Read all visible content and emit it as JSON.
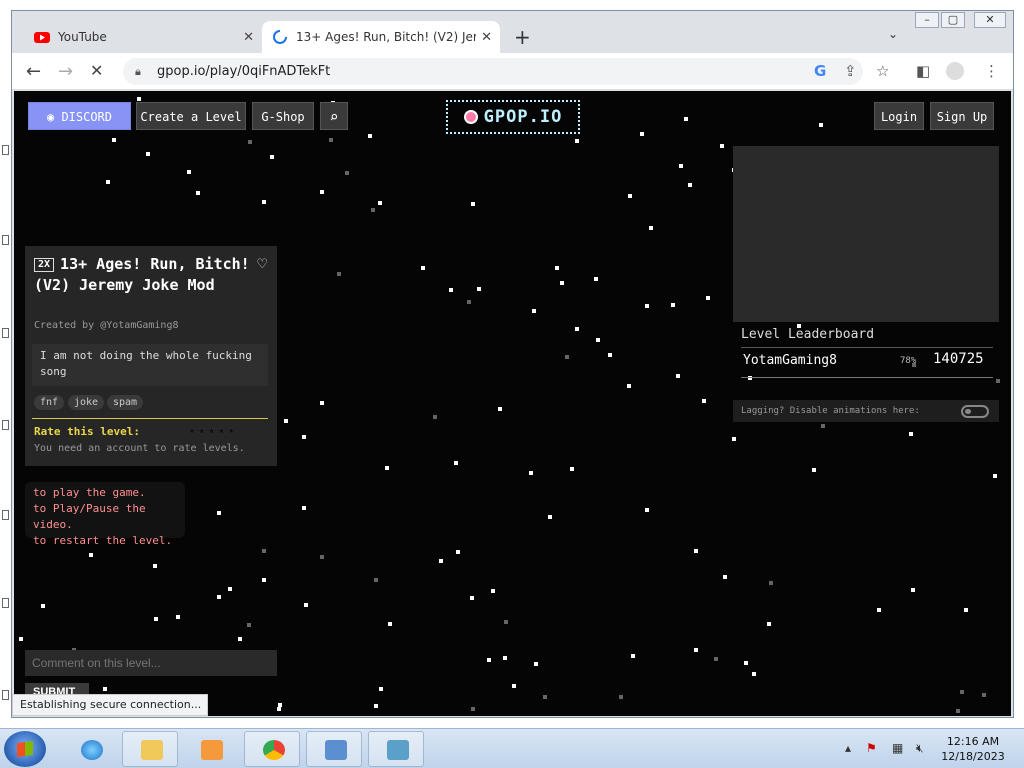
{
  "browser": {
    "tabs": [
      {
        "title": "YouTube",
        "icon": "youtube-icon",
        "active": false
      },
      {
        "title": "13+ Ages! Run, Bitch! (V2) Jerem",
        "icon": "loading-spinner-icon",
        "active": true
      }
    ],
    "url": "gpop.io/play/0qiFnADTekFt",
    "status_text": "Establishing secure connection..."
  },
  "site": {
    "discord_label": "DISCORD",
    "create_label": "Create a Level",
    "shop_label": "G-Shop",
    "logo_text": "GPOP.IO",
    "login_label": "Login",
    "signup_label": "Sign Up"
  },
  "level": {
    "speed_badge": "2X",
    "title": "13+ Ages! Run, Bitch! (V2) Jeremy Joke Mod",
    "created_by": "Created by @YotamGaming8",
    "description": "I am not doing the whole fucking song",
    "tags": [
      "fnf",
      "joke",
      "spam"
    ],
    "rate_label": "Rate this level:",
    "rate_stars": "★★★★★",
    "rate_note": "You need an account to rate levels."
  },
  "controls": {
    "line1": "to play the game.",
    "line2": "to Play/Pause the video.",
    "line3": "to restart the level."
  },
  "comments": {
    "placeholder": "Comment on this level...",
    "submit_label": "SUBMIT"
  },
  "leaderboard": {
    "title": "Level Leaderboard",
    "entries": [
      {
        "name": "YotamGaming8",
        "percent": "78%",
        "score": "140725"
      }
    ],
    "lag_text": "Lagging? Disable animations here:"
  },
  "taskbar": {
    "time": "12:16 AM",
    "date": "12/18/2023"
  }
}
